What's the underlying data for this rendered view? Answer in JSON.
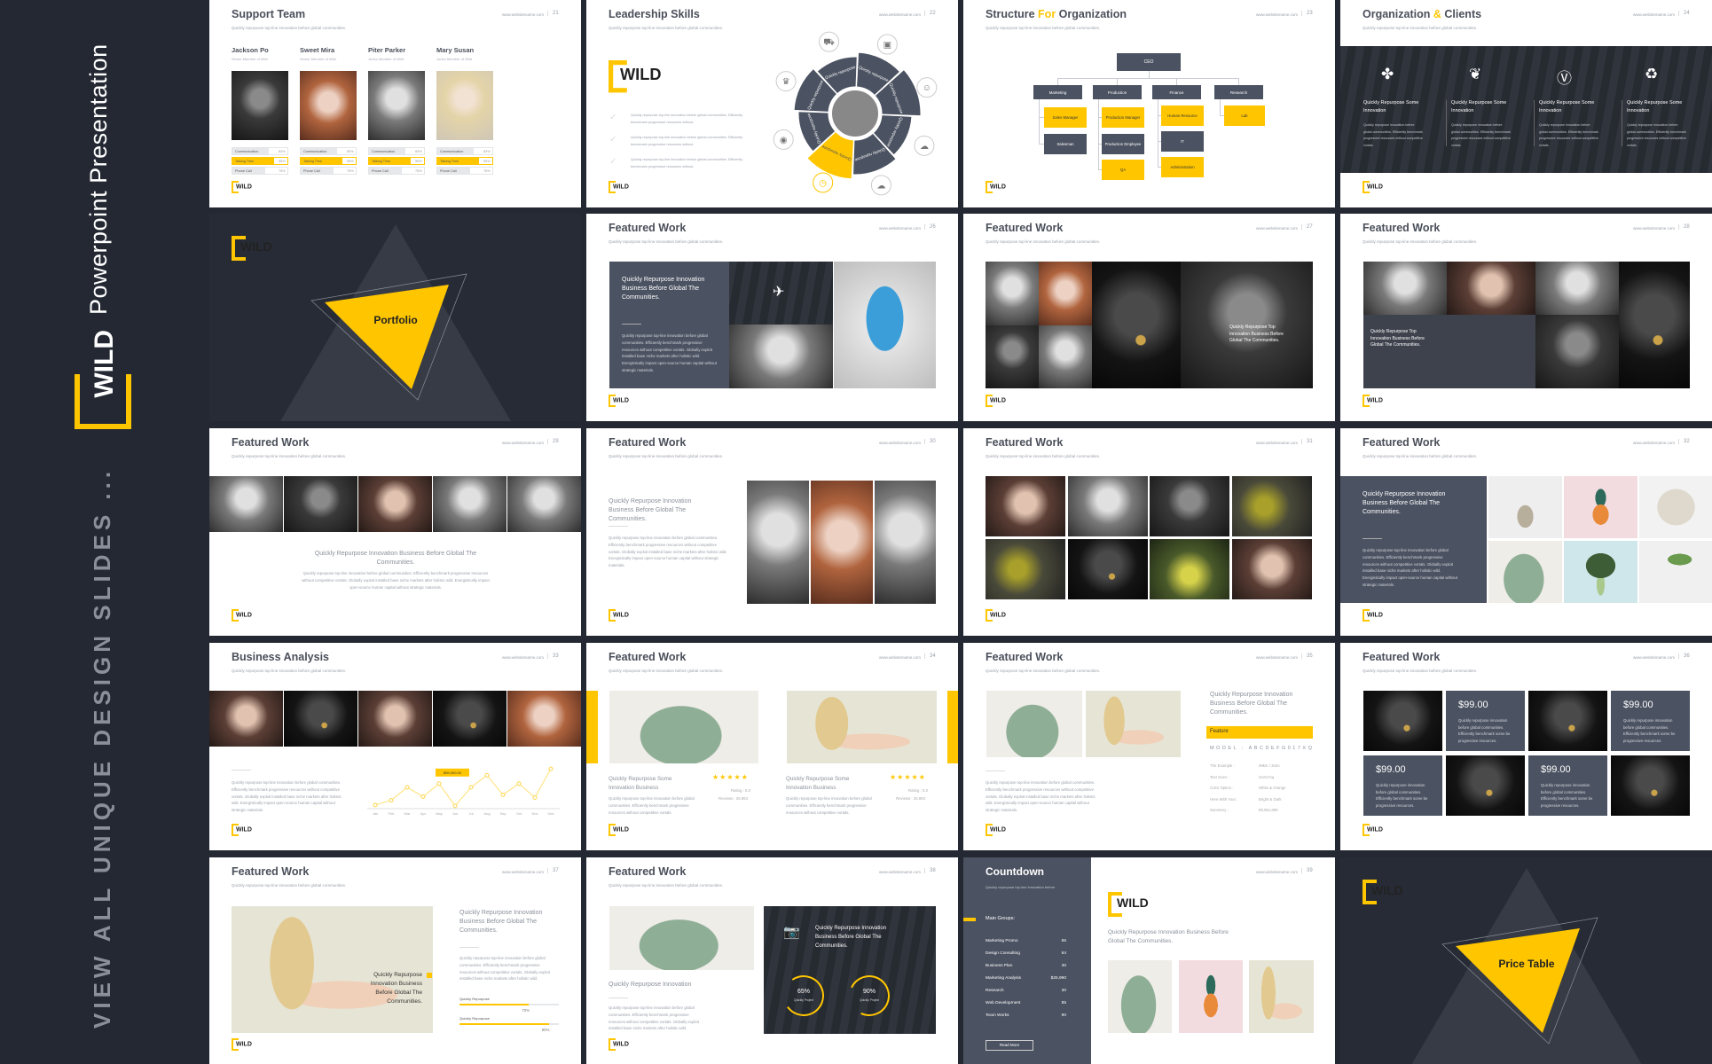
{
  "sidebar": {
    "brand": "WILD",
    "title": "Powerpoint Presentation",
    "tagline": "VIEW ALL UNIQUE DESIGN SLIDES ..."
  },
  "common": {
    "url": "www.websitename.com",
    "subtitle": "Quickly repurpose top-line innovation before global communities.",
    "logo": "WILD",
    "featured": "Featured Work",
    "body": "Quickly repurpose top-line innovation before global communities. Efficiently benchmark progressive resources without competitive vortals. Globally exploit installed base niche markets after holistic wild. Energistically impact open-source human capital without strategic materials.",
    "body_short": "Quickly repurpose top-line innovation before global communities. Efficiently benchmark progressive resources without competitive vortals. Globally exploit installed base niche markets after holistic wild.",
    "heading": "Quickly Repurpose Innovation Business Before Global The Communities."
  },
  "colors": {
    "accent": "#ffc600",
    "background": "#232833",
    "slate": "#4b5261",
    "text": "#4a4f5a"
  },
  "slides": [
    {
      "title": "Support Team",
      "page": "21",
      "members": [
        {
          "name": "Jackson Po",
          "role": "Senior Member of Wild"
        },
        {
          "name": "Sweet Mira",
          "role": "Senior Member of Wild"
        },
        {
          "name": "Piter Parker",
          "role": "Junior Member of Wild"
        },
        {
          "name": "Mary Susan",
          "role": "Junior Member of Wild"
        }
      ],
      "skills": [
        {
          "label": "Communication",
          "value": "83%"
        },
        {
          "label": "Talking Time",
          "value": "95%"
        },
        {
          "label": "Phone Call",
          "value": "75%"
        }
      ]
    },
    {
      "title": "Leadership Skills",
      "page": "22",
      "checks": [
        "Quickly repurpose top-line innovation before global communities. Efficiently benchmark progressive resources without.",
        "Quickly repurpose top-line innovation before global communities. Efficiently benchmark progressive resources without.",
        "Quickly repurpose top-line innovation before global communities. Efficiently benchmark progressive resources without."
      ],
      "wheel": {
        "labels": [
          "Quickly repurpose",
          "Quickly repurpose",
          "Quickly repurpose",
          "Quickly repurpose",
          "Quickly repurpose",
          "Quickly repurpose",
          "Quickly repurpose",
          "Quickly repurpose"
        ],
        "icons": [
          "truck-icon",
          "film-icon",
          "user-icon",
          "cloud-upload-icon",
          "cloud-chart-icon",
          "stopwatch-icon",
          "camera-icon",
          "crown-icon"
        ],
        "highlight": 5
      }
    },
    {
      "title_parts": [
        "Structure ",
        "For",
        " Organization"
      ],
      "page": "23",
      "ceo": "CEO",
      "departments": [
        {
          "name": "Marketing",
          "roles": [
            {
              "name": "Sales Manager",
              "accent": true
            },
            {
              "name": "Salesman",
              "accent": false
            }
          ]
        },
        {
          "name": "Production",
          "roles": [
            {
              "name": "Production Manager",
              "accent": true
            },
            {
              "name": "Production Employee",
              "accent": false
            },
            {
              "name": "QA",
              "accent": true
            }
          ]
        },
        {
          "name": "Finance",
          "roles": [
            {
              "name": "Human Resource",
              "accent": true
            },
            {
              "name": "IT",
              "accent": false
            },
            {
              "name": "Administration",
              "accent": true
            }
          ]
        },
        {
          "name": "Research",
          "roles": [
            {
              "name": "Lab",
              "accent": true
            }
          ]
        }
      ]
    },
    {
      "title_parts": [
        "Organization ",
        "&",
        " Clients"
      ],
      "page": "24",
      "columns": [
        {
          "icon": "pinwheel-icon",
          "title": "Quickly Repurpose Some Innovation",
          "text": "Quickly repurpose innovation before global communities. Efficiently benchmark progressive resources without competitive vortals."
        },
        {
          "icon": "leaf-icon",
          "title": "Quickly Repurpose Some Innovation",
          "text": "Quickly repurpose innovation before global communities. Efficiently benchmark progressive resources without competitive vortals."
        },
        {
          "icon": "v-badge-icon",
          "title": "Quickly Repurpose Some Innovation",
          "text": "Quickly repurpose innovation before global communities. Efficiently benchmark progressive resources without competitive vortals."
        },
        {
          "icon": "recycle-icon",
          "title": "Quickly Repurpose Some Innovation",
          "text": "Quickly repurpose innovation before global communities. Efficiently benchmark progressive resources without competitive vortals."
        }
      ]
    },
    {
      "label": "Portfolio"
    },
    {
      "page": "26"
    },
    {
      "page": "27",
      "caption": "Quickly Repurpose Top Innovation Business Before Global The Communities."
    },
    {
      "page": "28",
      "caption": "Quickly Repurpose Top Innovation Business Before Global The Communities."
    },
    {
      "page": "29"
    },
    {
      "page": "30"
    },
    {
      "page": "31"
    },
    {
      "page": "32"
    },
    {
      "title": "Business Analysis",
      "page": "33"
    },
    {
      "page": "34",
      "cards": [
        {
          "title": "Quickly Repurpose Some Innovation Business",
          "stars": 5,
          "rating": "Rating : 5.0",
          "reviews": "Reviews :  26,983",
          "text": "Quickly repurpose top-line innovation before global communities. Efficiently benchmark progressive resources without competitive vortals."
        },
        {
          "title": "Quickly Repurpose Some Innovation Business",
          "stars": 5,
          "rating": "Rating : 5.0",
          "reviews": "Reviews :  26,983",
          "text": "Quickly repurpose top-line innovation before global communities. Efficiently benchmark progressive resources without competitive vortals."
        }
      ]
    },
    {
      "page": "35",
      "feature": "Feature",
      "model": "MODEL  :  ABCDEFG017XQ",
      "specs": [
        {
          "k": "The Example :",
          "v": "09km / 3mm"
        },
        {
          "k": "Text Goes :",
          "v": "Gx017xq"
        },
        {
          "k": "Color Option :",
          "v": "White & Orange"
        },
        {
          "k": "Here With Your :",
          "v": "Bright & Dark"
        },
        {
          "k": "Summery :",
          "v": "99,051,890"
        }
      ]
    },
    {
      "page": "36",
      "prices": [
        {
          "price": "$99.00",
          "text": "Quickly repurpose innovation before global communities. Efficiently benchmark some be progressive resources."
        },
        {
          "price": "$99.00",
          "text": "Quickly repurpose innovation before global communities. Efficiently benchmark some be progressive resources."
        },
        {
          "price": "$99.00",
          "text": "Quickly repurpose innovation before global communities. Efficiently benchmark some be progressive resources."
        },
        {
          "price": "$99.00",
          "text": "Quickly repurpose innovation before global communities. Efficiently benchmark some be progressive resources."
        }
      ]
    },
    {
      "page": "37",
      "progress": [
        {
          "label": "Quickly Repurpose",
          "value": "70%"
        },
        {
          "label": "Quickly Repurpose",
          "value": "90%"
        }
      ]
    },
    {
      "page": "38",
      "heading": "Quickly Repurpose Innovation",
      "rings": [
        {
          "value": "65%",
          "label": "Quickly Project"
        },
        {
          "value": "90%",
          "label": "Quickly Project"
        }
      ]
    },
    {
      "title": "Countdown",
      "page": "39",
      "subtitle": "Quickly repurpose top-line innovation before",
      "groups_label": "Main Groups:",
      "groups": [
        {
          "k": "Marketing  Promo",
          "v": "65"
        },
        {
          "k": "Design Consulting",
          "v": "84"
        },
        {
          "k": "Business Plan",
          "v": "30"
        },
        {
          "k": "Marketing  Analysis",
          "v": "$25,990"
        },
        {
          "k": "Research",
          "v": "30"
        },
        {
          "k": "Web Development",
          "v": "85"
        },
        {
          "k": "Team Works",
          "v": "90"
        }
      ],
      "button": "Read More",
      "heading": "Quickly Repurpose Innovation Business Before Global The Communities."
    },
    {
      "label": "Price Table"
    }
  ],
  "chart_data": {
    "type": "line",
    "categories": [
      "Jan",
      "Feb",
      "Mar",
      "Apr",
      "May",
      "Jun",
      "Jul",
      "Aug",
      "Sep",
      "Oct",
      "Nov",
      "Des"
    ],
    "values": [
      4,
      9,
      23,
      13,
      27,
      3,
      23,
      36,
      15,
      27,
      12,
      43
    ],
    "ylim": [
      0,
      45
    ],
    "annotation": {
      "category": "May",
      "text": "$99,000.00"
    },
    "grid": false,
    "color": "#ffc600"
  }
}
